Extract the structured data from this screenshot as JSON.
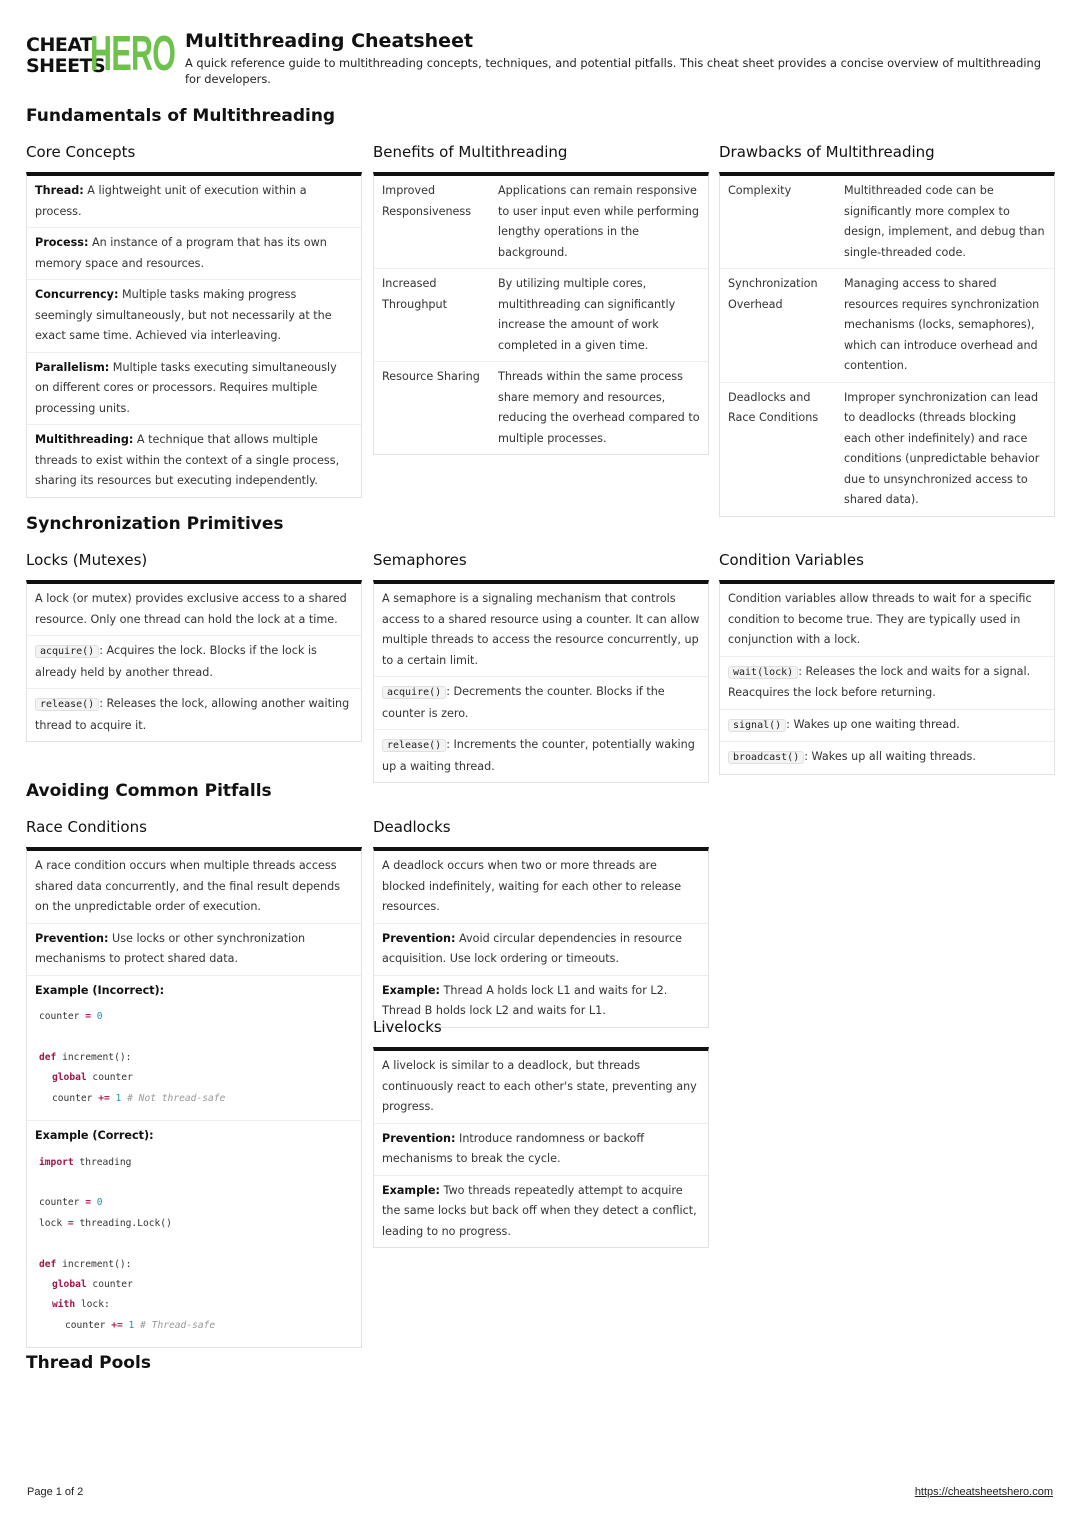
{
  "header": {
    "logo_top": "CHEAT",
    "logo_bottom": "SHEETS",
    "logo_hero": "HERO",
    "title": "Multithreading Cheatsheet",
    "description": "A quick reference guide to multithreading concepts, techniques, and potential pitfalls. This cheat sheet provides a concise overview of multithreading for developers."
  },
  "sections": {
    "fundamentals": {
      "heading": "Fundamentals of Multithreading",
      "core": {
        "title": "Core Concepts",
        "items": [
          {
            "term": "Thread:",
            "text": " A lightweight unit of execution within a process."
          },
          {
            "term": "Process:",
            "text": " An instance of a program that has its own memory space and resources."
          },
          {
            "term": "Concurrency:",
            "text": " Multiple tasks making progress seemingly simultaneously, but not necessarily at the exact same time. Achieved via interleaving."
          },
          {
            "term": "Parallelism:",
            "text": " Multiple tasks executing simultaneously on different cores or processors. Requires multiple processing units."
          },
          {
            "term": "Multithreading:",
            "text": " A technique that allows multiple threads to exist within the context of a single process, sharing its resources but executing independently."
          }
        ]
      },
      "benefits": {
        "title": "Benefits of Multithreading",
        "rows": [
          {
            "k": "Improved Responsiveness",
            "v": "Applications can remain responsive to user input even while performing lengthy operations in the background."
          },
          {
            "k": "Increased Throughput",
            "v": "By utilizing multiple cores, multithreading can significantly increase the amount of work completed in a given time."
          },
          {
            "k": "Resource Sharing",
            "v": "Threads within the same process share memory and resources, reducing the overhead compared to multiple processes."
          }
        ]
      },
      "drawbacks": {
        "title": "Drawbacks of Multithreading",
        "rows": [
          {
            "k": "Complexity",
            "v": "Multithreaded code can be significantly more complex to design, implement, and debug than single-threaded code."
          },
          {
            "k": "Synchronization Overhead",
            "v": "Managing access to shared resources requires synchronization mechanisms (locks, semaphores), which can introduce overhead and contention."
          },
          {
            "k": "Deadlocks and Race Conditions",
            "v": "Improper synchronization can lead to deadlocks (threads blocking each other indefinitely) and race conditions (unpredictable behavior due to unsynchronized access to shared data)."
          }
        ]
      }
    },
    "sync": {
      "heading": "Synchronization Primitives",
      "locks": {
        "title": "Locks (Mutexes)",
        "intro": "A lock (or mutex) provides exclusive access to a shared resource. Only one thread can hold the lock at a time.",
        "items": [
          {
            "code": "acquire()",
            "text": ": Acquires the lock. Blocks if the lock is already held by another thread."
          },
          {
            "code": "release()",
            "text": ": Releases the lock, allowing another waiting thread to acquire it."
          }
        ]
      },
      "semaphores": {
        "title": "Semaphores",
        "intro": "A semaphore is a signaling mechanism that controls access to a shared resource using a counter. It can allow multiple threads to access the resource concurrently, up to a certain limit.",
        "items": [
          {
            "code": "acquire()",
            "text": ": Decrements the counter. Blocks if the counter is zero."
          },
          {
            "code": "release()",
            "text": ": Increments the counter, potentially waking up a waiting thread."
          }
        ]
      },
      "condvars": {
        "title": "Condition Variables",
        "intro": "Condition variables allow threads to wait for a specific condition to become true. They are typically used in conjunction with a lock.",
        "items": [
          {
            "code": "wait(lock)",
            "text": ": Releases the lock and waits for a signal. Reacquires the lock before returning."
          },
          {
            "code": "signal()",
            "text": ": Wakes up one waiting thread."
          },
          {
            "code": "broadcast()",
            "text": ": Wakes up all waiting threads."
          }
        ]
      }
    },
    "pitfalls": {
      "heading": "Avoiding Common Pitfalls",
      "race": {
        "title": "Race Conditions",
        "intro": "A race condition occurs when multiple threads access shared data concurrently, and the final result depends on the unpredictable order of execution.",
        "prevention_label": "Prevention:",
        "prevention_text": " Use locks or other synchronization mechanisms to protect shared data.",
        "incorrect_label": "Example (Incorrect):",
        "correct_label": "Example (Correct):",
        "code_incorrect": {
          "l1_a": "counter ",
          "l1_op": "=",
          "l1_num": " 0",
          "l2_kw": "def",
          "l2_rest": " increment():",
          "l3_kw": "global",
          "l3_rest": " counter",
          "l4_a": "counter ",
          "l4_op": "+=",
          "l4_num": " 1",
          "l4_cm": " # Not thread-safe"
        },
        "code_correct": {
          "l1_kw": "import",
          "l1_rest": " threading",
          "l2_a": "counter ",
          "l2_op": "=",
          "l2_num": " 0",
          "l3_a": "lock ",
          "l3_op": "=",
          "l3_rest": " threading.Lock()",
          "l4_kw": "def",
          "l4_rest": " increment():",
          "l5_kw": "global",
          "l5_rest": " counter",
          "l6_kw": "with",
          "l6_rest": " lock:",
          "l7_a": "counter ",
          "l7_op": "+=",
          "l7_num": " 1",
          "l7_cm": " # Thread-safe"
        }
      },
      "deadlocks": {
        "title": "Deadlocks",
        "intro": "A deadlock occurs when two or more threads are blocked indefinitely, waiting for each other to release resources.",
        "items": [
          {
            "term": "Prevention:",
            "text": " Avoid circular dependencies in resource acquisition. Use lock ordering or timeouts."
          },
          {
            "term": "Example:",
            "text": " Thread A holds lock L1 and waits for L2. Thread B holds lock L2 and waits for L1."
          }
        ]
      },
      "livelocks": {
        "title": "Livelocks",
        "intro": "A livelock is similar to a deadlock, but threads continuously react to each other's state, preventing any progress.",
        "items": [
          {
            "term": "Prevention:",
            "text": " Introduce randomness or backoff mechanisms to break the cycle."
          },
          {
            "term": "Example:",
            "text": " Two threads repeatedly attempt to acquire the same locks but back off when they detect a conflict, leading to no progress."
          }
        ]
      }
    },
    "threadpools": {
      "heading": "Thread Pools"
    }
  },
  "footer": {
    "page": "Page 1 of 2",
    "link": "https://cheatsheetshero.com"
  }
}
